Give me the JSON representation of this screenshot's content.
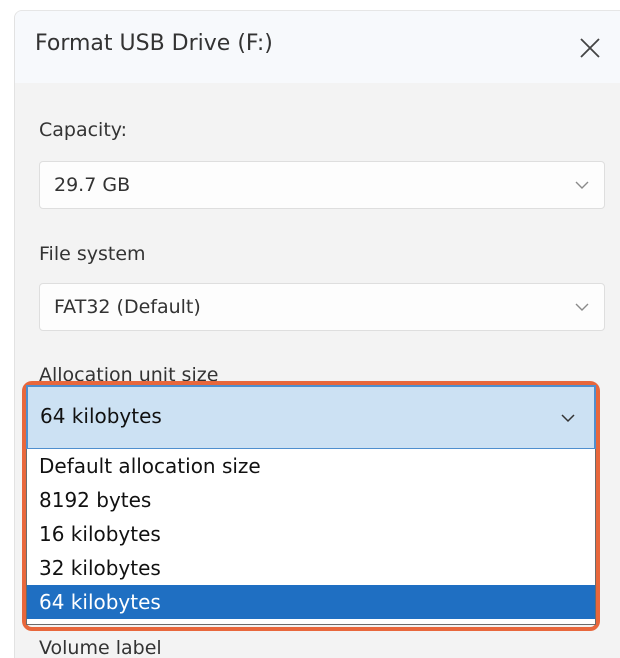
{
  "window": {
    "title": "Format USB Drive (F:)"
  },
  "capacity": {
    "label": "Capacity:",
    "value": "29.7 GB"
  },
  "file_system": {
    "label": "File system",
    "value": "FAT32 (Default)"
  },
  "allocation": {
    "label": "Allocation unit size",
    "value": "64 kilobytes",
    "options": [
      "Default allocation size",
      "8192 bytes",
      "16 kilobytes",
      "32 kilobytes",
      "64 kilobytes"
    ],
    "selected": "64 kilobytes"
  },
  "volume": {
    "label": "Volume label"
  },
  "icons": {
    "close": "close-icon",
    "chevron": "chevron-down-icon"
  },
  "colors": {
    "highlight_border": "#e8673c",
    "selected_item": "#1f6fc2",
    "combo_focus": "#cce1f3"
  }
}
